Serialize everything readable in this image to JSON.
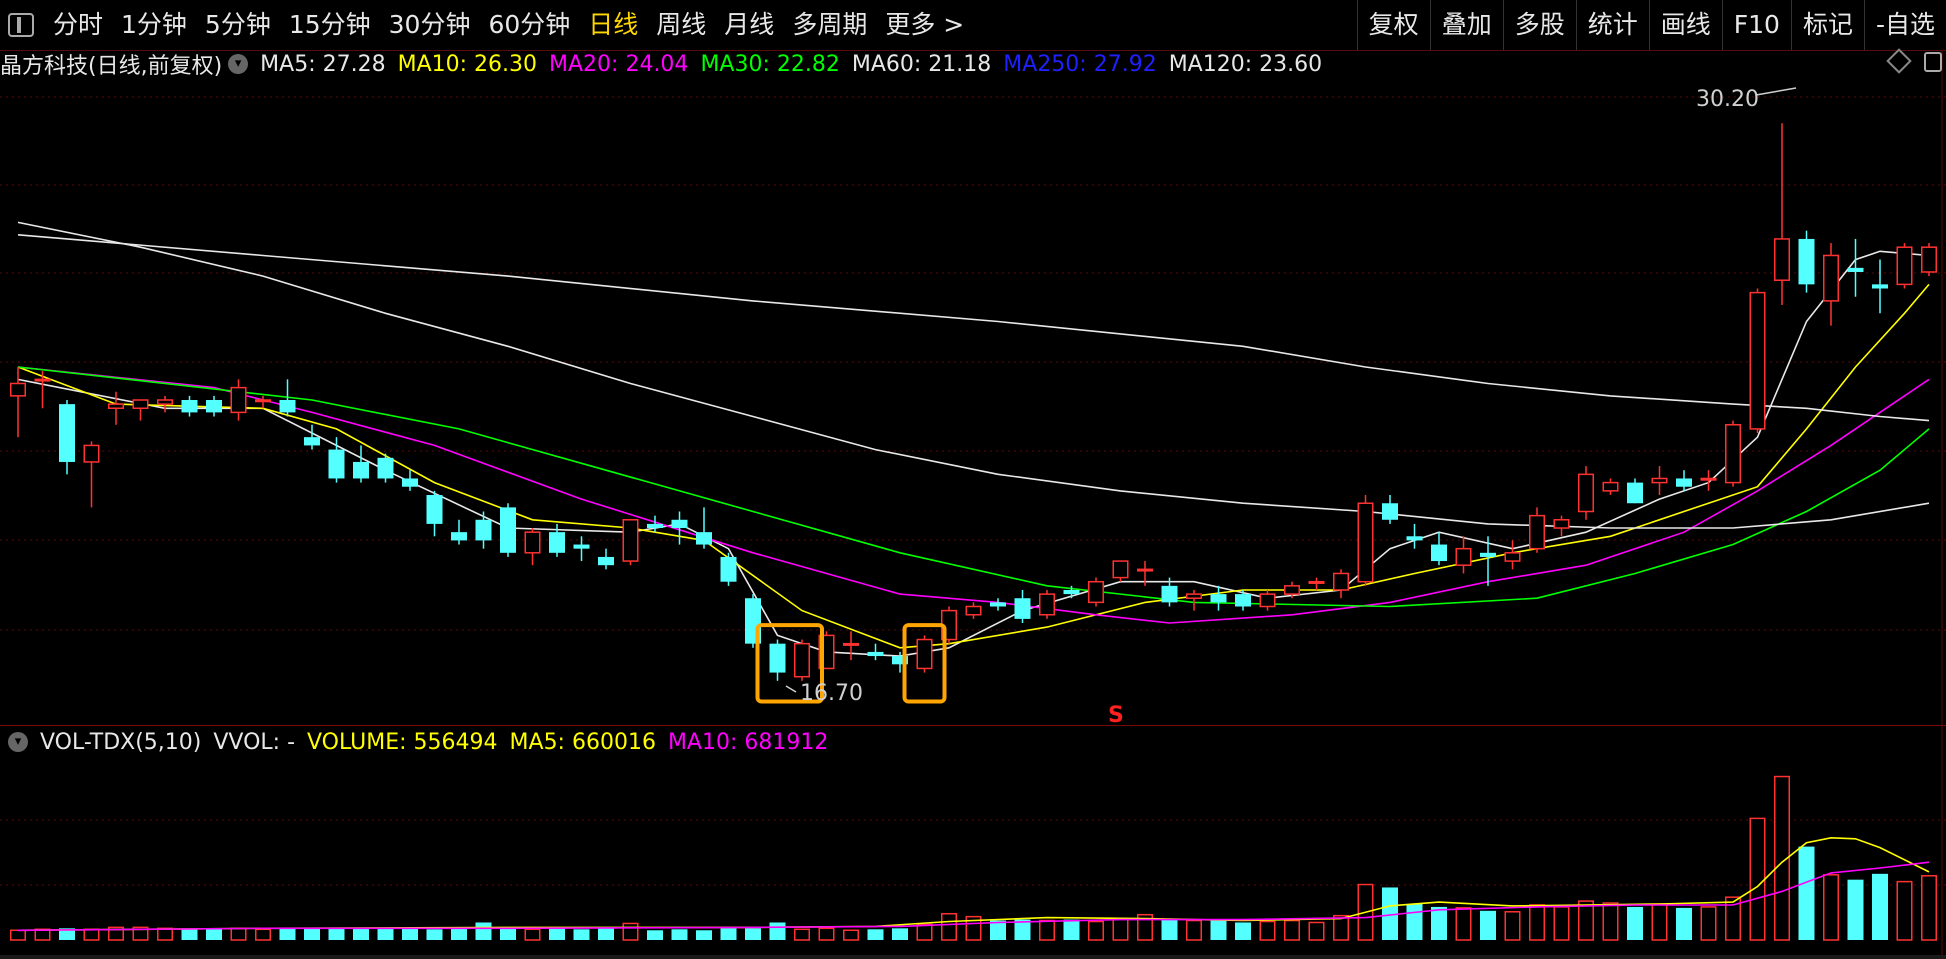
{
  "toolbar": {
    "left_items": [
      "分时",
      "1分钟",
      "5分钟",
      "15分钟",
      "30分钟",
      "60分钟",
      "日线",
      "周线",
      "月线",
      "多周期",
      "更多 >"
    ],
    "active_item": "日线",
    "right_items": [
      "复权",
      "叠加",
      "多股",
      "统计",
      "画线",
      "F10",
      "标记",
      "-自选"
    ]
  },
  "legend": {
    "stock": "晶方科技(日线,前复权)",
    "ma": [
      {
        "label": "MA5: 27.28",
        "color": "#e8e8e8"
      },
      {
        "label": "MA10: 26.30",
        "color": "#ffff00"
      },
      {
        "label": "MA20: 24.04",
        "color": "#ff00ff"
      },
      {
        "label": "MA30: 22.82",
        "color": "#00ff00"
      },
      {
        "label": "MA60: 21.18",
        "color": "#e8e8e8"
      },
      {
        "label": "MA250: 27.92",
        "color": "#2020ff"
      },
      {
        "label": "MA120: 23.60",
        "color": "#e8e8e8"
      }
    ]
  },
  "volume_legend": {
    "indicator": "VOL-TDX(5,10)",
    "vvol": "VVOL: -",
    "items": [
      {
        "label": "VOLUME: 556494",
        "color": "#ffff00"
      },
      {
        "label": "MA5: 660016",
        "color": "#ffff00"
      },
      {
        "label": "MA10: 681912",
        "color": "#ff00ff"
      }
    ]
  },
  "annotations": {
    "high_label": "30.20",
    "low_label": "16.70",
    "signal": "S"
  },
  "colors": {
    "up": "#ff3232",
    "down": "#54ffff",
    "bg": "#000000",
    "grid": "#5a0a0a",
    "highlight": "#ffa500"
  },
  "chart_data": {
    "type": "candlestick",
    "ylim": [
      15.8,
      31.2
    ],
    "candles": [
      [
        23.6,
        24.3,
        23.9,
        22.6
      ],
      [
        24.0,
        24.2,
        24.0,
        23.3
      ],
      [
        23.4,
        23.5,
        22.0,
        21.7
      ],
      [
        22.0,
        22.5,
        22.4,
        20.9
      ],
      [
        23.3,
        23.7,
        23.4,
        22.9
      ],
      [
        23.3,
        23.5,
        23.5,
        23.0
      ],
      [
        23.4,
        23.6,
        23.5,
        23.2
      ],
      [
        23.5,
        23.6,
        23.2,
        23.1
      ],
      [
        23.5,
        23.6,
        23.2,
        23.1
      ],
      [
        23.2,
        24.0,
        23.8,
        23.0
      ],
      [
        23.5,
        23.6,
        23.5,
        23.3
      ],
      [
        23.5,
        24.0,
        23.2,
        23.1
      ],
      [
        22.6,
        22.9,
        22.4,
        22.3
      ],
      [
        22.3,
        22.6,
        21.6,
        21.5
      ],
      [
        22.0,
        22.4,
        21.6,
        21.5
      ],
      [
        22.1,
        22.2,
        21.6,
        21.5
      ],
      [
        21.6,
        21.8,
        21.4,
        21.3
      ],
      [
        21.2,
        21.3,
        20.5,
        20.2
      ],
      [
        20.3,
        20.6,
        20.1,
        20.0
      ],
      [
        20.6,
        20.8,
        20.1,
        19.9
      ],
      [
        20.9,
        21.0,
        19.8,
        19.7
      ],
      [
        19.8,
        20.4,
        20.3,
        19.5
      ],
      [
        20.3,
        20.5,
        19.8,
        19.7
      ],
      [
        20.0,
        20.2,
        19.9,
        19.6
      ],
      [
        19.7,
        19.9,
        19.5,
        19.4
      ],
      [
        19.6,
        20.6,
        20.6,
        19.5
      ],
      [
        20.5,
        20.7,
        20.4,
        20.3
      ],
      [
        20.6,
        20.8,
        20.4,
        20.0
      ],
      [
        20.3,
        20.9,
        20.0,
        19.9
      ],
      [
        19.7,
        19.8,
        19.1,
        19.0
      ],
      [
        18.7,
        18.8,
        17.6,
        17.5
      ],
      [
        17.6,
        17.7,
        16.9,
        16.7
      ],
      [
        16.8,
        17.7,
        17.6,
        16.7
      ],
      [
        17.0,
        17.9,
        17.8,
        17.0
      ],
      [
        17.6,
        17.9,
        17.6,
        17.2
      ],
      [
        17.4,
        17.6,
        17.3,
        17.2
      ],
      [
        17.3,
        17.4,
        17.1,
        16.9
      ],
      [
        17.0,
        17.8,
        17.7,
        16.9
      ],
      [
        17.7,
        18.5,
        18.4,
        17.6
      ],
      [
        18.3,
        18.6,
        18.5,
        18.2
      ],
      [
        18.6,
        18.7,
        18.5,
        18.4
      ],
      [
        18.7,
        18.9,
        18.2,
        18.1
      ],
      [
        18.3,
        18.9,
        18.8,
        18.2
      ],
      [
        18.9,
        19.0,
        18.8,
        18.7
      ],
      [
        18.6,
        19.2,
        19.1,
        18.5
      ],
      [
        19.2,
        19.6,
        19.6,
        19.1
      ],
      [
        19.4,
        19.6,
        19.4,
        19.0
      ],
      [
        19.0,
        19.2,
        18.6,
        18.5
      ],
      [
        18.7,
        18.9,
        18.8,
        18.4
      ],
      [
        18.8,
        19.0,
        18.6,
        18.4
      ],
      [
        18.8,
        18.9,
        18.5,
        18.4
      ],
      [
        18.5,
        18.9,
        18.8,
        18.4
      ],
      [
        18.8,
        19.1,
        19.0,
        18.7
      ],
      [
        19.1,
        19.2,
        19.1,
        18.9
      ],
      [
        18.9,
        19.4,
        19.3,
        18.7
      ],
      [
        19.1,
        21.2,
        21.0,
        19.0
      ],
      [
        21.0,
        21.2,
        20.6,
        20.5
      ],
      [
        20.2,
        20.5,
        20.1,
        19.9
      ],
      [
        20.0,
        20.3,
        19.6,
        19.5
      ],
      [
        19.5,
        20.2,
        19.9,
        19.3
      ],
      [
        19.8,
        20.2,
        19.7,
        19.0
      ],
      [
        19.6,
        20.1,
        19.8,
        19.4
      ],
      [
        19.9,
        20.9,
        20.7,
        19.8
      ],
      [
        20.4,
        20.7,
        20.6,
        20.2
      ],
      [
        20.8,
        21.9,
        21.7,
        20.6
      ],
      [
        21.3,
        21.6,
        21.5,
        21.2
      ],
      [
        21.5,
        21.6,
        21.0,
        21.0
      ],
      [
        21.5,
        21.9,
        21.6,
        21.2
      ],
      [
        21.6,
        21.8,
        21.4,
        21.3
      ],
      [
        21.6,
        21.8,
        21.6,
        21.3
      ],
      [
        21.5,
        23.0,
        22.9,
        21.4
      ],
      [
        22.8,
        26.2,
        26.1,
        22.7
      ],
      [
        26.4,
        30.2,
        27.4,
        25.8
      ],
      [
        27.4,
        27.6,
        26.3,
        26.1
      ],
      [
        25.9,
        27.3,
        27.0,
        25.3
      ],
      [
        26.7,
        27.4,
        26.6,
        26.0
      ],
      [
        26.3,
        26.9,
        26.2,
        25.6
      ],
      [
        26.3,
        27.3,
        27.2,
        26.2
      ],
      [
        26.6,
        27.3,
        27.2,
        26.5
      ]
    ],
    "ma_series": [
      {
        "name": "MA5",
        "color": "#e8e8e8",
        "points": [
          [
            0,
            24.0
          ],
          [
            6,
            23.3
          ],
          [
            10,
            23.3
          ],
          [
            15,
            21.8
          ],
          [
            20,
            20.4
          ],
          [
            25,
            20.3
          ],
          [
            27,
            20.5
          ],
          [
            29,
            19.9
          ],
          [
            31,
            17.8
          ],
          [
            33,
            17.4
          ],
          [
            36,
            17.3
          ],
          [
            38,
            17.5
          ],
          [
            41,
            18.4
          ],
          [
            45,
            19.1
          ],
          [
            48,
            19.1
          ],
          [
            51,
            18.7
          ],
          [
            54,
            18.9
          ],
          [
            56,
            19.9
          ],
          [
            58,
            20.3
          ],
          [
            61,
            19.9
          ],
          [
            64,
            20.3
          ],
          [
            67,
            21.1
          ],
          [
            69,
            21.5
          ],
          [
            71,
            22.6
          ],
          [
            73,
            25.4
          ],
          [
            75,
            26.9
          ],
          [
            76,
            27.1
          ],
          [
            78,
            27.0
          ]
        ]
      },
      {
        "name": "MA10",
        "color": "#ffff00",
        "points": [
          [
            0,
            24.3
          ],
          [
            4,
            23.4
          ],
          [
            10,
            23.3
          ],
          [
            13,
            22.8
          ],
          [
            17,
            21.5
          ],
          [
            21,
            20.6
          ],
          [
            25,
            20.4
          ],
          [
            28,
            20.1
          ],
          [
            32,
            18.4
          ],
          [
            36,
            17.5
          ],
          [
            38,
            17.6
          ],
          [
            42,
            18.0
          ],
          [
            46,
            18.6
          ],
          [
            50,
            18.9
          ],
          [
            54,
            18.9
          ],
          [
            57,
            19.3
          ],
          [
            61,
            19.8
          ],
          [
            65,
            20.2
          ],
          [
            69,
            21.0
          ],
          [
            71,
            21.4
          ],
          [
            73,
            22.8
          ],
          [
            75,
            24.3
          ],
          [
            77,
            25.6
          ],
          [
            78,
            26.3
          ]
        ]
      },
      {
        "name": "MA20",
        "color": "#ff00ff",
        "points": [
          [
            0,
            24.3
          ],
          [
            8,
            23.8
          ],
          [
            12,
            23.2
          ],
          [
            17,
            22.4
          ],
          [
            23,
            21.1
          ],
          [
            30,
            19.8
          ],
          [
            36,
            18.8
          ],
          [
            40,
            18.6
          ],
          [
            44,
            18.3
          ],
          [
            47,
            18.1
          ],
          [
            52,
            18.3
          ],
          [
            56,
            18.6
          ],
          [
            60,
            19.1
          ],
          [
            64,
            19.5
          ],
          [
            68,
            20.3
          ],
          [
            71,
            21.3
          ],
          [
            74,
            22.4
          ],
          [
            78,
            24.0
          ]
        ]
      },
      {
        "name": "MA30",
        "color": "#00ff00",
        "points": [
          [
            0,
            24.3
          ],
          [
            6,
            23.9
          ],
          [
            12,
            23.5
          ],
          [
            18,
            22.8
          ],
          [
            24,
            21.8
          ],
          [
            30,
            20.8
          ],
          [
            36,
            19.8
          ],
          [
            42,
            19.0
          ],
          [
            48,
            18.6
          ],
          [
            56,
            18.5
          ],
          [
            62,
            18.7
          ],
          [
            66,
            19.3
          ],
          [
            70,
            20.0
          ],
          [
            73,
            20.8
          ],
          [
            76,
            21.8
          ],
          [
            78,
            22.8
          ]
        ]
      },
      {
        "name": "MA60",
        "color": "#e8e8e8",
        "points": [
          [
            0,
            27.5
          ],
          [
            10,
            27.0
          ],
          [
            20,
            26.5
          ],
          [
            30,
            25.9
          ],
          [
            40,
            25.4
          ],
          [
            50,
            24.8
          ],
          [
            55,
            24.3
          ],
          [
            60,
            23.9
          ],
          [
            65,
            23.6
          ],
          [
            70,
            23.4
          ],
          [
            73,
            23.3
          ],
          [
            76,
            23.1
          ],
          [
            78,
            23.0
          ]
        ]
      },
      {
        "name": "MA250",
        "color": "#e8e8e8",
        "points": [
          [
            0,
            27.8
          ],
          [
            5,
            27.2
          ],
          [
            10,
            26.5
          ],
          [
            15,
            25.6
          ],
          [
            20,
            24.8
          ],
          [
            25,
            23.9
          ],
          [
            30,
            23.1
          ],
          [
            35,
            22.3
          ],
          [
            40,
            21.7
          ],
          [
            45,
            21.3
          ],
          [
            50,
            21.0
          ],
          [
            55,
            20.8
          ],
          [
            60,
            20.5
          ],
          [
            65,
            20.4
          ],
          [
            70,
            20.4
          ],
          [
            74,
            20.6
          ],
          [
            78,
            21.0
          ]
        ]
      }
    ],
    "volume": {
      "values": [
        1.0,
        1.1,
        1.2,
        1.1,
        1.3,
        1.3,
        1.2,
        1.1,
        1.2,
        1.2,
        1.1,
        1.2,
        1.2,
        1.2,
        1.2,
        1.2,
        1.2,
        1.1,
        1.2,
        1.8,
        1.2,
        1.1,
        1.2,
        1.1,
        1.2,
        1.7,
        1.0,
        1.1,
        1.0,
        1.2,
        1.2,
        1.8,
        1.1,
        1.2,
        1.0,
        1.1,
        1.2,
        1.6,
        2.7,
        2.4,
        2.0,
        2.1,
        2.0,
        2.1,
        1.9,
        2.2,
        2.6,
        2.1,
        2.0,
        2.0,
        1.8,
        1.9,
        2.0,
        1.8,
        2.5,
        5.7,
        5.4,
        3.7,
        3.4,
        3.3,
        3.0,
        2.9,
        3.6,
        3.4,
        4.0,
        3.8,
        3.4,
        3.7,
        3.3,
        3.4,
        4.4,
        12.5,
        16.8,
        9.6,
        6.7,
        6.2,
        6.8,
        6.0,
        6.6
      ],
      "ma5": [
        [
          0,
          1.0
        ],
        [
          10,
          1.2
        ],
        [
          20,
          1.3
        ],
        [
          30,
          1.3
        ],
        [
          35,
          1.4
        ],
        [
          38,
          1.9
        ],
        [
          42,
          2.3
        ],
        [
          46,
          2.2
        ],
        [
          50,
          2.0
        ],
        [
          54,
          2.2
        ],
        [
          56,
          3.5
        ],
        [
          58,
          3.9
        ],
        [
          61,
          3.5
        ],
        [
          64,
          3.6
        ],
        [
          67,
          3.7
        ],
        [
          70,
          3.9
        ],
        [
          71,
          5.5
        ],
        [
          72,
          8.0
        ],
        [
          73,
          10.0
        ],
        [
          74,
          10.5
        ],
        [
          75,
          10.4
        ],
        [
          76,
          9.5
        ],
        [
          78,
          7.0
        ]
      ],
      "ma10": [
        [
          0,
          1.0
        ],
        [
          10,
          1.2
        ],
        [
          20,
          1.2
        ],
        [
          30,
          1.3
        ],
        [
          36,
          1.4
        ],
        [
          40,
          1.8
        ],
        [
          45,
          2.1
        ],
        [
          50,
          2.1
        ],
        [
          55,
          2.3
        ],
        [
          58,
          3.1
        ],
        [
          62,
          3.4
        ],
        [
          66,
          3.6
        ],
        [
          70,
          3.6
        ],
        [
          72,
          5.0
        ],
        [
          74,
          6.9
        ],
        [
          76,
          7.4
        ],
        [
          78,
          8.0
        ]
      ],
      "ylim": [
        0,
        18.5
      ]
    }
  }
}
